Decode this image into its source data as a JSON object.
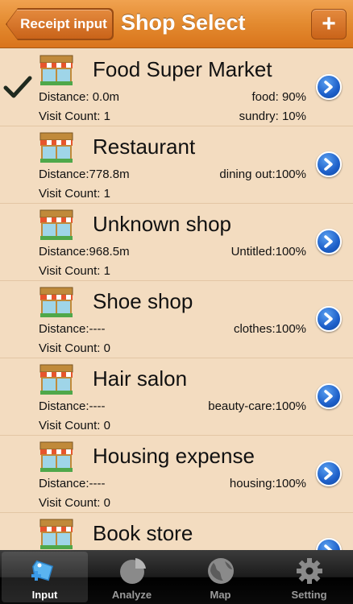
{
  "navbar": {
    "back_label": "Receipt input",
    "title": "Shop Select",
    "add_label": "+"
  },
  "shops": [
    {
      "name": "Food Super Market",
      "distance": "Distance: 0.0m",
      "category": "food: 90%",
      "visit": "Visit Count:  1",
      "extra": "sundry: 10%",
      "selected": true
    },
    {
      "name": "Restaurant",
      "distance": "Distance:778.8m",
      "category": "dining out:100%",
      "visit": "Visit Count:  1",
      "extra": ""
    },
    {
      "name": "Unknown shop",
      "distance": "Distance:968.5m",
      "category": "Untitled:100%",
      "visit": "Visit Count:  1",
      "extra": ""
    },
    {
      "name": "Shoe shop",
      "distance": "Distance:----",
      "category": "clothes:100%",
      "visit": "Visit Count:  0",
      "extra": ""
    },
    {
      "name": "Hair salon",
      "distance": "Distance:----",
      "category": "beauty-care:100%",
      "visit": "Visit Count:  0",
      "extra": ""
    },
    {
      "name": "Housing expense",
      "distance": "Distance:----",
      "category": "housing:100%",
      "visit": "Visit Count:  0",
      "extra": ""
    },
    {
      "name": "Book store",
      "distance": "",
      "category": "",
      "visit": "",
      "extra": ""
    }
  ],
  "tabs": [
    {
      "label": "Input",
      "icon": "tag-add-icon",
      "selected": true
    },
    {
      "label": "Analyze",
      "icon": "pie-chart-icon"
    },
    {
      "label": "Map",
      "icon": "globe-icon"
    },
    {
      "label": "Setting",
      "icon": "gear-icon"
    }
  ],
  "colors": {
    "navbar": "#e38a2f",
    "list_background": "#f3dcc0",
    "disclosure": "#1d5fc9",
    "tabbar": "#1b1b1b"
  }
}
